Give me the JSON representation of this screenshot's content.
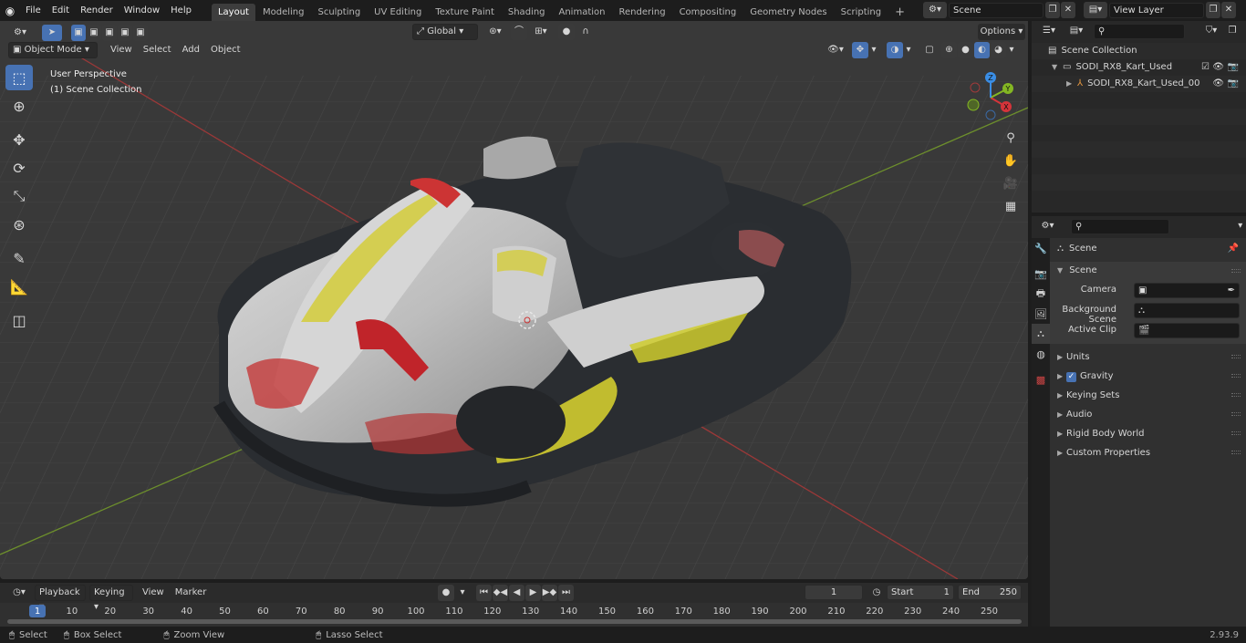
{
  "topbar": {
    "menus": [
      "File",
      "Edit",
      "Render",
      "Window",
      "Help"
    ],
    "workspaces": [
      "Layout",
      "Modeling",
      "Sculpting",
      "UV Editing",
      "Texture Paint",
      "Shading",
      "Animation",
      "Rendering",
      "Compositing",
      "Geometry Nodes",
      "Scripting"
    ],
    "active_workspace": "Layout",
    "add_tab": "+",
    "scene": "Scene",
    "view_layer": "View Layer"
  },
  "viewport": {
    "mode": "Object Mode",
    "menus": [
      "View",
      "Select",
      "Add",
      "Object"
    ],
    "orientation": "Global",
    "options_label": "Options",
    "overlay_line1": "User Perspective",
    "overlay_line2": "(1) Scene Collection",
    "gizmo": {
      "x": "X",
      "y": "Y",
      "z": "Z"
    }
  },
  "timeline": {
    "menus": [
      "Playback",
      "Keying",
      "View",
      "Marker"
    ],
    "current_frame": "1",
    "start_label": "Start",
    "start_value": "1",
    "end_label": "End",
    "end_value": "250",
    "ruler": [
      "1",
      "10",
      "20",
      "30",
      "40",
      "50",
      "60",
      "70",
      "80",
      "90",
      "100",
      "110",
      "120",
      "130",
      "140",
      "150",
      "160",
      "170",
      "180",
      "190",
      "200",
      "210",
      "220",
      "230",
      "240",
      "250"
    ]
  },
  "outliner": {
    "root": "Scene Collection",
    "collection": "SODI_RX8_Kart_Used",
    "object": "SODI_RX8_Kart_Used_00"
  },
  "properties": {
    "context": "Scene",
    "panel": "Scene",
    "camera_label": "Camera",
    "background_label": "Background Scene",
    "clip_label": "Active Clip",
    "sections": [
      "Units",
      "Gravity",
      "Keying Sets",
      "Audio",
      "Rigid Body World",
      "Custom Properties"
    ]
  },
  "statusbar": {
    "items": [
      "Select",
      "Box Select",
      "Zoom View",
      "Lasso Select"
    ],
    "version": "2.93.9"
  },
  "colors": {
    "accent": "#4772b3",
    "axis_x": "#d5343a",
    "axis_y": "#84b723",
    "axis_z": "#3a8ee6"
  }
}
